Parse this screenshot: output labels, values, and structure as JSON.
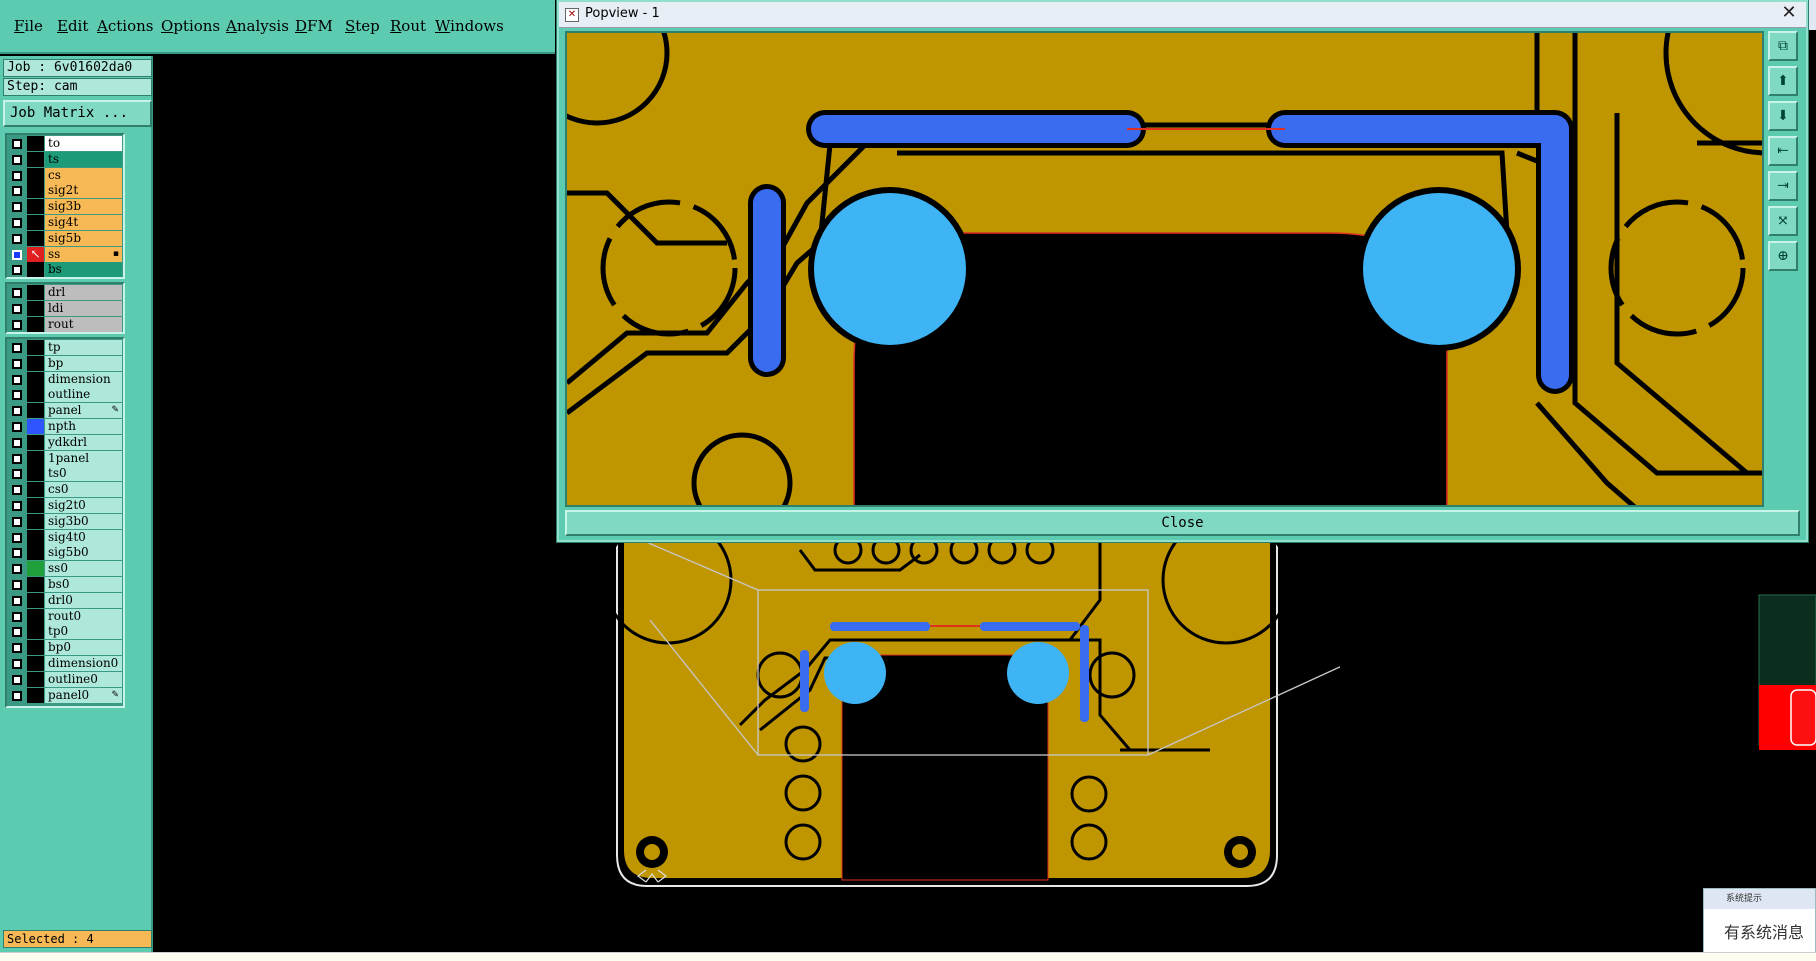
{
  "menubar": {
    "items": [
      "File",
      "Edit",
      "Actions",
      "Options",
      "Analysis",
      "DFM",
      "Step",
      "Rout",
      "Windows"
    ]
  },
  "left_panel": {
    "job_label": "Job : 6v01602da0",
    "step_label": "Step: cam",
    "job_matrix_button": "Job Matrix ...",
    "status": "Selected : 4",
    "groups": [
      {
        "layers": [
          {
            "name": "to",
            "color": "white"
          },
          {
            "name": "ts",
            "color": "green"
          },
          {
            "name": "cs",
            "color": "orange"
          },
          {
            "name": "sig2t",
            "color": "orange"
          },
          {
            "name": "sig3b",
            "color": "orange"
          },
          {
            "name": "sig4t",
            "color": "orange"
          },
          {
            "name": "sig5b",
            "color": "orange"
          },
          {
            "name": "ss",
            "color": "orange",
            "active": true
          },
          {
            "name": "bs",
            "color": "green"
          }
        ]
      },
      {
        "layers": [
          {
            "name": "drl",
            "color": "gray"
          },
          {
            "name": "ldi",
            "color": "gray"
          },
          {
            "name": "rout",
            "color": "gray"
          }
        ]
      },
      {
        "layers": [
          {
            "name": "tp",
            "color": "cyan"
          },
          {
            "name": "bp",
            "color": "cyan"
          },
          {
            "name": "dimension",
            "color": "cyan"
          },
          {
            "name": "outline",
            "color": "cyan"
          },
          {
            "name": "panel",
            "color": "cyan",
            "flag": "pencil"
          },
          {
            "name": "npth",
            "color": "cyan",
            "swatch": "#2f55ff"
          },
          {
            "name": "ydkdrl",
            "color": "cyan"
          },
          {
            "name": "1panel",
            "color": "cyan"
          },
          {
            "name": "ts0",
            "color": "cyan"
          },
          {
            "name": "cs0",
            "color": "cyan"
          },
          {
            "name": "sig2t0",
            "color": "cyan"
          },
          {
            "name": "sig3b0",
            "color": "cyan"
          },
          {
            "name": "sig4t0",
            "color": "cyan"
          },
          {
            "name": "sig5b0",
            "color": "cyan"
          },
          {
            "name": "ss0",
            "color": "cyan",
            "swatch": "#1fa03a"
          },
          {
            "name": "bs0",
            "color": "cyan"
          },
          {
            "name": "drl0",
            "color": "cyan"
          },
          {
            "name": "rout0",
            "color": "cyan"
          },
          {
            "name": "tp0",
            "color": "cyan"
          },
          {
            "name": "bp0",
            "color": "cyan"
          },
          {
            "name": "dimension0",
            "color": "cyan"
          },
          {
            "name": "outline0",
            "color": "cyan"
          },
          {
            "name": "panel0",
            "color": "cyan",
            "flag": "pencil"
          }
        ]
      }
    ]
  },
  "popview": {
    "title": "Popview - 1",
    "close_button": "Close",
    "toolbar_icons": [
      "zoom-window-icon",
      "zoom-in-icon",
      "zoom-out-icon",
      "pan-left-icon",
      "pan-right-icon",
      "fit-screen-icon",
      "zoom-home-icon"
    ]
  },
  "notification": {
    "title": "系统提示",
    "text": "有系统消息"
  },
  "colors": {
    "copper": "#bf9500",
    "feature_blue": "#3a6cf0",
    "pad_light_blue": "#3eb4f5",
    "panel_teal": "#5dcbb0",
    "layer_orange": "#f7b955"
  }
}
